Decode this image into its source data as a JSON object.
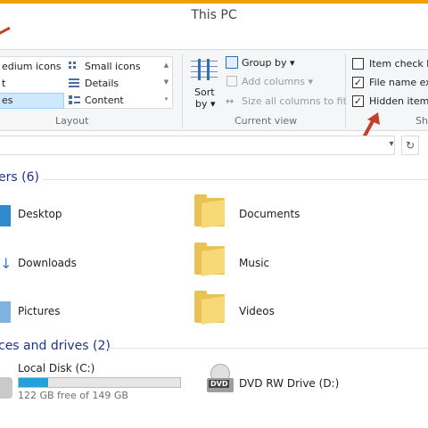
{
  "window": {
    "title": "This PC"
  },
  "ribbon": {
    "layout": {
      "group_label": "Layout",
      "items": [
        {
          "label": "edium icons"
        },
        {
          "label": "Small icons"
        },
        {
          "label": "t"
        },
        {
          "label": "Details"
        },
        {
          "label": "es"
        },
        {
          "label": "Content"
        }
      ]
    },
    "current_view": {
      "group_label": "Current view",
      "sort_label_1": "Sort",
      "sort_label_2": "by",
      "group_by": "Group by",
      "add_columns": "Add columns",
      "size_columns": "Size all columns to fit"
    },
    "show_hide": {
      "group_label": "Sh",
      "items": [
        {
          "label": "Item check bo",
          "checked": false
        },
        {
          "label": "File name ext",
          "checked": true
        },
        {
          "label": "Hidden items",
          "checked": true
        }
      ]
    }
  },
  "content": {
    "folders_header": "ers (6)",
    "folders": [
      {
        "name": "Desktop"
      },
      {
        "name": "Documents"
      },
      {
        "name": "Downloads"
      },
      {
        "name": "Music"
      },
      {
        "name": "Pictures"
      },
      {
        "name": "Videos"
      }
    ],
    "drives_header": "ces and drives (2)",
    "drives": [
      {
        "name": "Local Disk (C:)",
        "free_text": "122 GB free of 149 GB",
        "used_fraction": 0.18
      },
      {
        "name": "DVD RW Drive (D:)",
        "badge": "DVD"
      }
    ]
  },
  "colors": {
    "accent": "#f0a000",
    "section_header": "#1e3287",
    "bar_fill": "#26a0da",
    "annotation_arrow": "#c2412b"
  }
}
